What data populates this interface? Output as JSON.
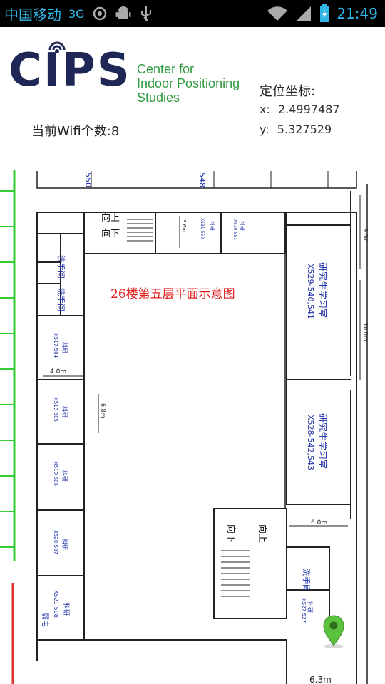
{
  "status_bar": {
    "carrier": "中国移动",
    "network": "3G",
    "time": "21:49",
    "icons": [
      "sync-icon",
      "android-icon",
      "usb-icon",
      "wifi-icon",
      "signal-icon",
      "battery-icon"
    ]
  },
  "header": {
    "logo_text": "CIPS",
    "logo_subtitle_lines": [
      "Center for",
      "Indoor Positioning",
      "Studies"
    ],
    "coord_title": "定位坐标:",
    "x_label": "x:",
    "x_value": "2.4997487",
    "y_label": "y:",
    "y_value": "5.327529",
    "wifi_label": "当前Wifi个数:",
    "wifi_count": "8"
  },
  "map": {
    "title": "26楼第五层平面示意图",
    "top_rooms": [
      "550",
      "548"
    ],
    "rooms": [
      {
        "name": "研究生学习室",
        "code": "X529-540,541"
      },
      {
        "name": "研究生学习室",
        "code": "X528-542,543"
      },
      {
        "name": "科研",
        "code": "X517-504"
      },
      {
        "name": "科研",
        "code": "X518-505"
      },
      {
        "name": "科研",
        "code": "X519-506"
      },
      {
        "name": "科研",
        "code": "X520-507"
      },
      {
        "name": "科研",
        "code": "X521-508"
      },
      {
        "name": "科研",
        "code": "X530-551"
      },
      {
        "name": "科研",
        "code": "X531-552"
      },
      {
        "name": "科研",
        "code": "X527-527"
      }
    ],
    "labels": {
      "up": "向上",
      "down": "向下",
      "washroom": "洗手间",
      "electric": "弱电"
    },
    "dimensions": [
      "4.0m",
      "6.0m",
      "9.6m",
      "10.0m",
      "6.3m",
      "6.8m",
      "3.6m"
    ],
    "colors": {
      "marker": "#5cc13f",
      "title": "#e02020",
      "wall": "#222222",
      "rail_green": "#33cc33",
      "rail_red": "#dd3333"
    }
  }
}
